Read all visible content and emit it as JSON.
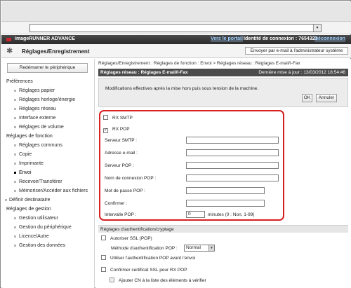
{
  "browser": {
    "url_value": "",
    "dropdown_glyph": "▾"
  },
  "header": {
    "brand_name": "imageRUNNER ADVANCE",
    "portal_link": "Vers le portail",
    "login_label": "Identité de connexion : 7654321",
    "logout_link": "Déconnexion"
  },
  "titlebar": {
    "title": "Réglages/Enregistrement",
    "mail_admin_button": "Envoyer par e-mail à l'administrateur système"
  },
  "sidebar": {
    "restart_button": "Redémarrer le périphérique",
    "preferences": "Préférences",
    "preferences_items": [
      {
        "label": "Réglages papier"
      },
      {
        "label": "Réglages horloge/énergie"
      },
      {
        "label": "Réglages réseau"
      },
      {
        "label": "Interface externe"
      },
      {
        "label": "Réglages de volume"
      }
    ],
    "function_settings": "Réglages de fonction",
    "function_items": [
      {
        "label": "Réglages communs"
      },
      {
        "label": "Copie"
      },
      {
        "label": "Imprimante"
      },
      {
        "label": "Envoi"
      },
      {
        "label": "Recevoir/Transférer"
      },
      {
        "label": "Mémoriser/Accéder aux fichiers"
      }
    ],
    "set_destination": "Définir destinataire",
    "management_settings": "Réglages de gestion",
    "management_items": [
      {
        "label": "Gestion utilisateur"
      },
      {
        "label": "Gestion du périphérique"
      },
      {
        "label": "Licence/Autre"
      },
      {
        "label": "Gestion des données"
      }
    ]
  },
  "main": {
    "breadcrumb": "Réglages/Enregistrement : Réglages de fonction : Envoi > Réglages réseau : Réglages E-mail/I-Fax",
    "section_title": "Réglages réseau : Réglages E-mail/I-Fax",
    "last_update": "Dernière mise à jour : 13/03/2012 18:54:46",
    "notice": "Modifications effectives après la mise hors puis sous tension de la machine.",
    "ok_button": "OK",
    "cancel_button": "Annuler",
    "rx_smtp_label": "RX SMTP",
    "rx_pop_label": "RX POP",
    "checkmark": "✓",
    "smtp_server_label": "Serveur SMTP :",
    "email_address_label": "Adresse e-mail :",
    "pop_server_label": "Serveur POP :",
    "pop_login_label": "Nom de connexion POP :",
    "pop_password_label": "Mot de passe POP :",
    "confirm_label": "Confirmer :",
    "pop_interval_label": "Intervalle POP :",
    "pop_interval_value": "0",
    "pop_interval_unit": "minutes (0 : Non, 1-99)",
    "smtp_server_value": "",
    "email_address_value": "",
    "pop_server_value": "",
    "pop_login_value": "",
    "pop_password_value": "",
    "confirm_value": "",
    "auth_header": "Réglages d'authentification/cryptage",
    "allow_ssl_label": "Autoriser SSL (POP)",
    "pop_auth_method_label": "Méthode d'authentification POP :",
    "pop_auth_method_value": "Normal",
    "pop_before_send_label": "Utiliser l'authentification POP avant l'envoi",
    "confirm_ssl_cert_label": "Confirmer certificat SSL pour RX POP",
    "add_cn_label": "Ajouter CN à la liste des éléments à vérifier"
  },
  "colors": {
    "highlight_border": "#d71f1f",
    "brand_bar": "#333333",
    "section_header": "#4b4b4b"
  }
}
